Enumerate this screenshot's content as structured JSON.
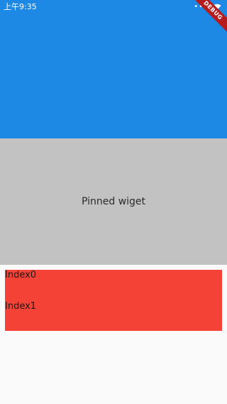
{
  "status_bar": {
    "time": "上午9:35",
    "indicators": "•••",
    "wifi_icon": "wifi-icon",
    "debug_banner": "DEBUG"
  },
  "pinned": {
    "label": "Pinned wiget"
  },
  "list": {
    "items": [
      {
        "label": "Index0"
      },
      {
        "label": "Index1"
      }
    ]
  },
  "colors": {
    "primary": "#1e88e5",
    "pinned_bg": "#c2c2c2",
    "list_bg": "#f44336",
    "page_bg": "#fafafa"
  }
}
